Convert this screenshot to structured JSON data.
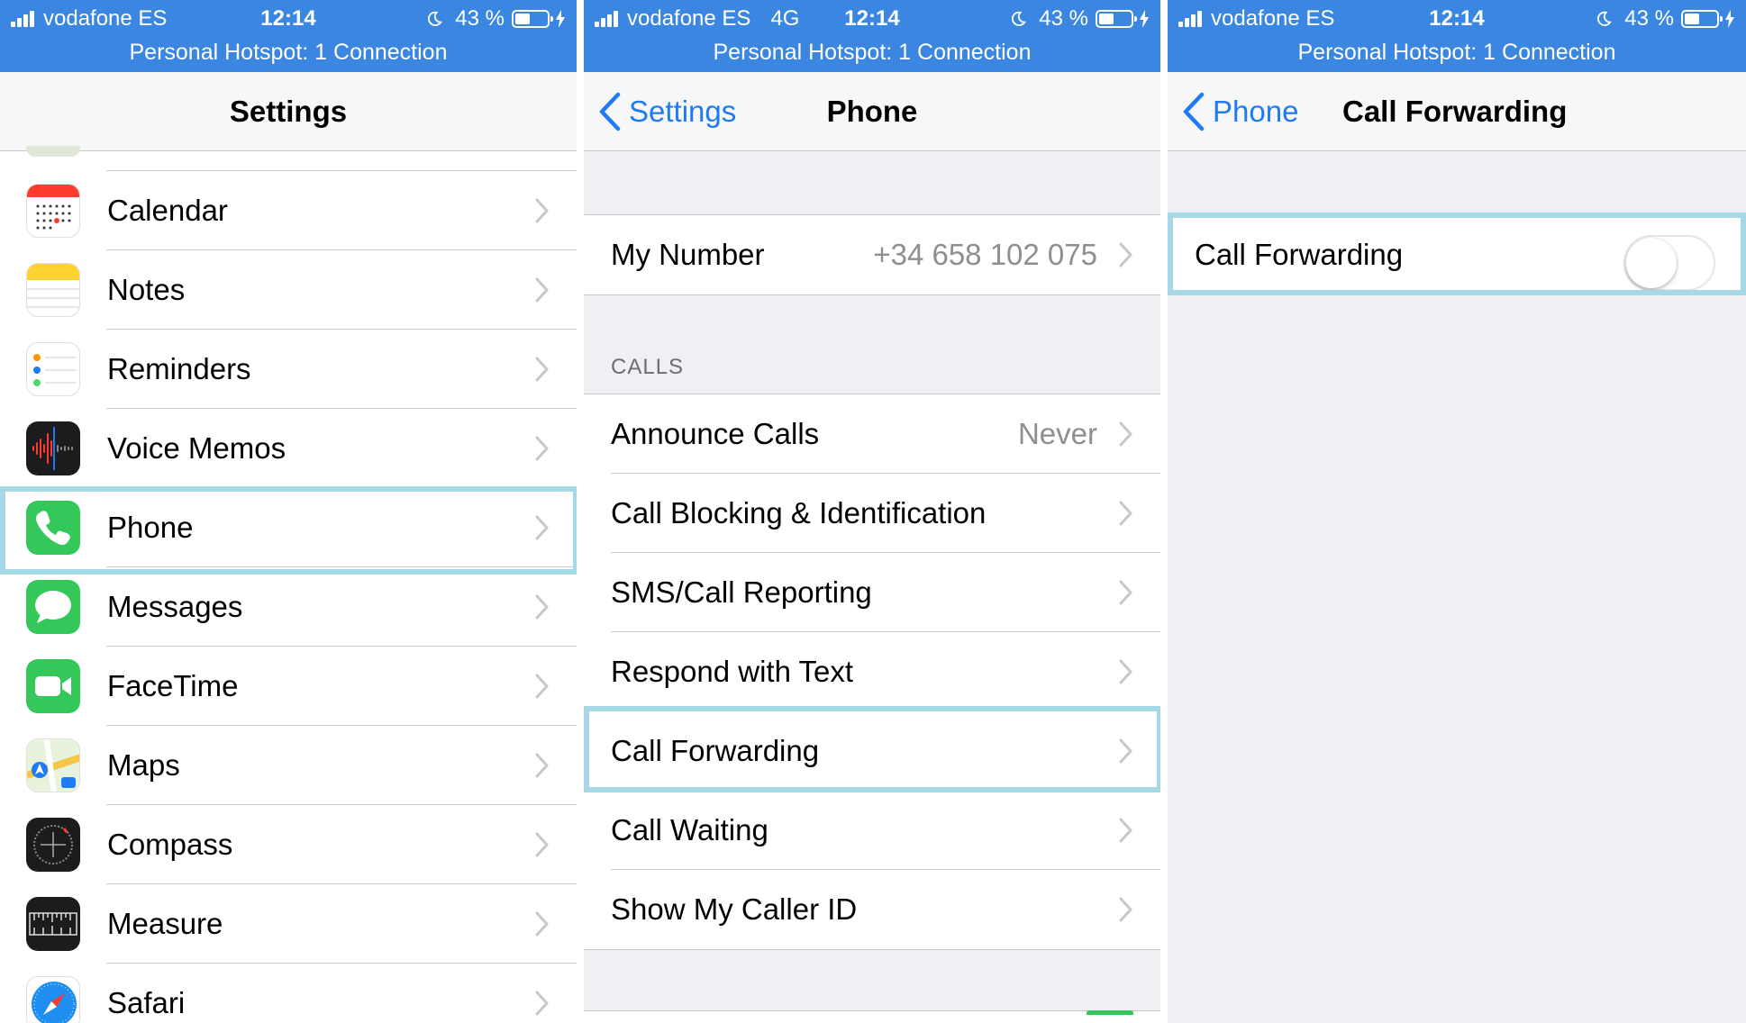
{
  "status_bars": [
    {
      "carrier": "vodafone ES",
      "network": "",
      "time": "12:14",
      "battery": "43 %",
      "battery_level": 0.43,
      "hotspot": "Personal Hotspot: 1 Connection"
    },
    {
      "carrier": "vodafone ES",
      "network": "4G",
      "time": "12:14",
      "battery": "43 %",
      "battery_level": 0.43,
      "hotspot": "Personal Hotspot: 1 Connection"
    },
    {
      "carrier": "vodafone ES",
      "network": "",
      "time": "12:14",
      "battery": "43 %",
      "battery_level": 0.43,
      "hotspot": "Personal Hotspot: 1 Connection"
    }
  ],
  "settings_screen": {
    "title": "Settings",
    "items": [
      {
        "label": "Calendar",
        "icon": "calendar-icon"
      },
      {
        "label": "Notes",
        "icon": "notes-icon"
      },
      {
        "label": "Reminders",
        "icon": "reminders-icon"
      },
      {
        "label": "Voice Memos",
        "icon": "voice-memos-icon"
      },
      {
        "label": "Phone",
        "icon": "phone-icon",
        "highlighted": true
      },
      {
        "label": "Messages",
        "icon": "messages-icon"
      },
      {
        "label": "FaceTime",
        "icon": "facetime-icon"
      },
      {
        "label": "Maps",
        "icon": "maps-icon"
      },
      {
        "label": "Compass",
        "icon": "compass-icon"
      },
      {
        "label": "Measure",
        "icon": "measure-icon"
      },
      {
        "label": "Safari",
        "icon": "safari-icon"
      }
    ]
  },
  "phone_screen": {
    "back_label": "Settings",
    "title": "Phone",
    "my_number_label": "My Number",
    "my_number_value": "+34 658 102 075",
    "calls_header": "CALLS",
    "items": [
      {
        "label": "Announce Calls",
        "value": "Never"
      },
      {
        "label": "Call Blocking & Identification",
        "value": ""
      },
      {
        "label": "SMS/Call Reporting",
        "value": ""
      },
      {
        "label": "Respond with Text",
        "value": ""
      },
      {
        "label": "Call Forwarding",
        "value": "",
        "highlighted": true
      },
      {
        "label": "Call Waiting",
        "value": ""
      },
      {
        "label": "Show My Caller ID",
        "value": ""
      }
    ]
  },
  "call_forwarding_screen": {
    "back_label": "Phone",
    "title": "Call Forwarding",
    "toggle_label": "Call Forwarding",
    "toggle_on": false
  },
  "colors": {
    "status_bar": "#3a86e0",
    "accent": "#1f7bf5",
    "highlight": "#a6d8e6",
    "group_background": "#efeff4"
  }
}
